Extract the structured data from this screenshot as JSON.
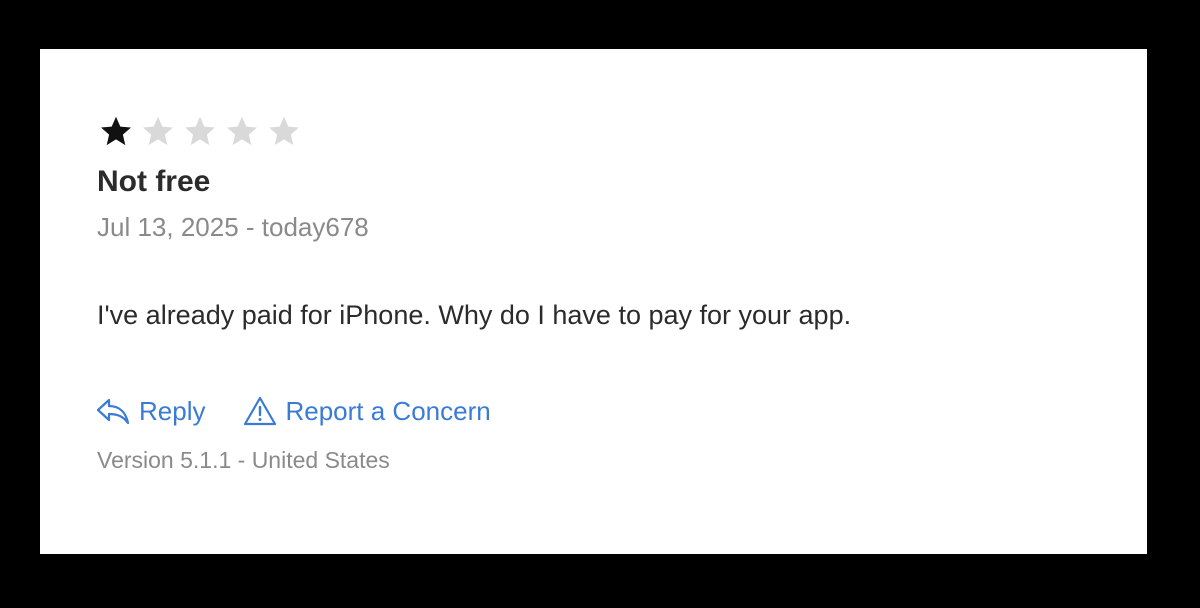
{
  "review": {
    "rating": 1,
    "max_rating": 5,
    "filled_star_color": "#111111",
    "empty_star_color": "#d9d9d9",
    "title": "Not free",
    "date_author": "Jul 13, 2025 - today678",
    "body": "I've already paid for iPhone. Why do I have to pay for your app.",
    "version_region": "Version 5.1.1 - United States"
  },
  "actions": {
    "reply_label": "Reply",
    "reply_icon": "reply-arrow-icon",
    "report_label": "Report a Concern",
    "report_icon": "warning-triangle-icon",
    "link_color": "#3a7bd5"
  }
}
